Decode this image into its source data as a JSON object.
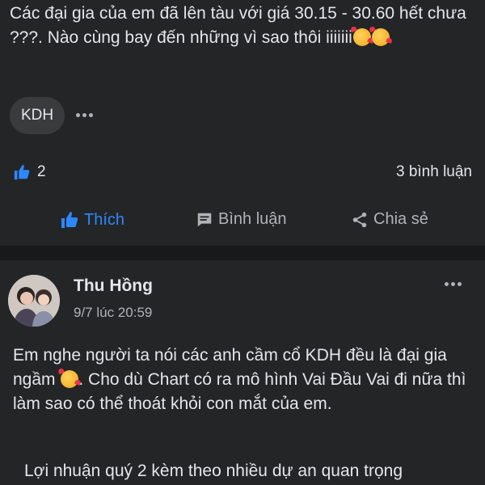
{
  "post1": {
    "text": "Các đại gia của em đã lên tàu với giá 30.15 - 30.60 hết chưa ???. Nào cùng bay đến những vì sao thôi iiiiiii",
    "emojis": [
      "smiling-face-with-hearts",
      "smiling-face-with-hearts"
    ],
    "tag": "KDH",
    "like_count": "2",
    "comment_count": "3 bình luận"
  },
  "actions": {
    "like": "Thích",
    "comment": "Bình luận",
    "share": "Chia sẻ"
  },
  "post2": {
    "author": "Thu Hồng",
    "timestamp": "9/7 lúc 20:59",
    "text_part1": "Em nghe người ta nói các anh cầm cổ KDH đều là đại gia ngầm",
    "text_part2": ". Cho dù Chart có ra mô hình Vai Đầu Vai đi nữa thì làm sao có thể thoát khỏi con mắt của em.",
    "text_para2": "Lợi nhuận quý 2 kèm theo nhiều dự an quan trọng"
  },
  "colors": {
    "background": "#18191a",
    "card": "#242526",
    "text": "#e4e6eb",
    "secondary": "#b0b3b8",
    "accent": "#2d88ff"
  }
}
